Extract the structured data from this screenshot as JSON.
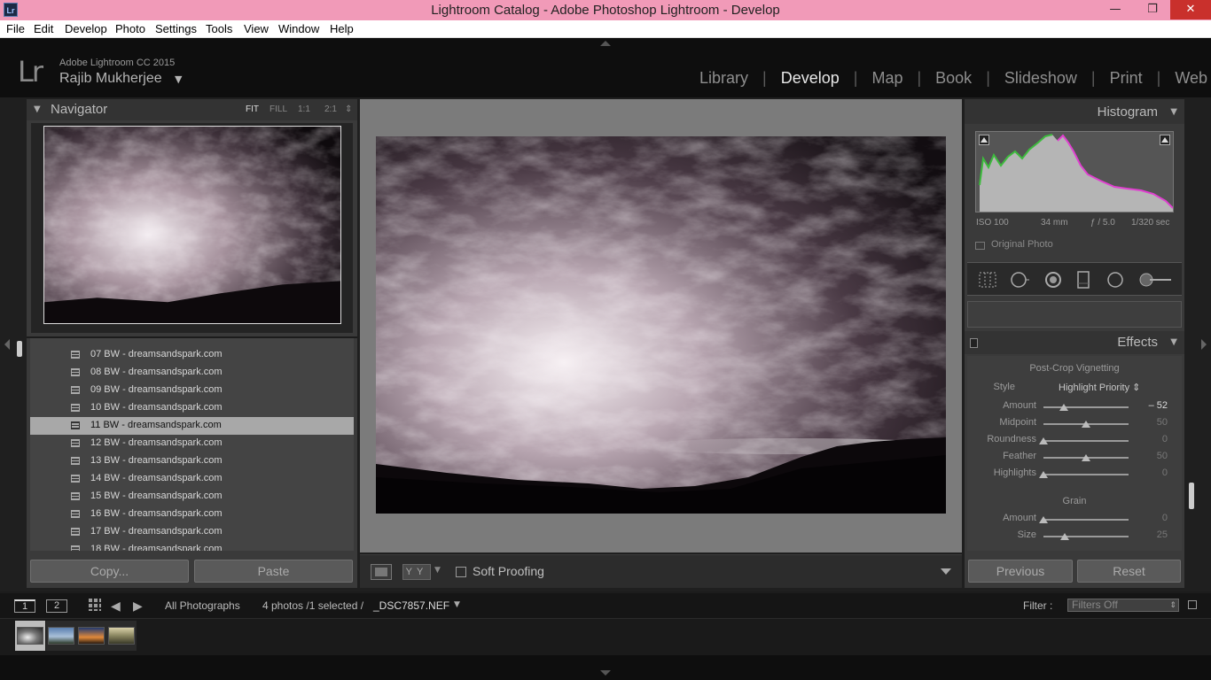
{
  "window": {
    "app_icon_text": "Lr",
    "title": "Lightroom Catalog - Adobe Photoshop Lightroom - Develop",
    "minimize": "—",
    "maximize": "❐",
    "close": "✕"
  },
  "menu": [
    "File",
    "Edit",
    "Develop",
    "Photo",
    "Settings",
    "Tools",
    "View",
    "Window",
    "Help"
  ],
  "identity": {
    "logo": "Lr",
    "product": "Adobe Lightroom CC 2015",
    "user": "Rajib Mukherjee",
    "caret": "▼"
  },
  "modules": [
    {
      "label": "Library",
      "active": false
    },
    {
      "label": "Develop",
      "active": true
    },
    {
      "label": "Map",
      "active": false
    },
    {
      "label": "Book",
      "active": false
    },
    {
      "label": "Slideshow",
      "active": false
    },
    {
      "label": "Print",
      "active": false
    },
    {
      "label": "Web",
      "active": false
    }
  ],
  "navigator": {
    "title": "Navigator",
    "collapse_glyph": "▼",
    "zoom_options": [
      "FIT",
      "FILL",
      "1:1",
      "2:1"
    ],
    "zoom_more": "⇕"
  },
  "snapshots": [
    "07 BW - dreamsandspark.com",
    "08 BW - dreamsandspark.com",
    "09 BW - dreamsandspark.com",
    "10 BW - dreamsandspark.com",
    "11 BW - dreamsandspark.com",
    "12 BW - dreamsandspark.com",
    "13 BW - dreamsandspark.com",
    "14 BW - dreamsandspark.com",
    "15 BW - dreamsandspark.com",
    "16 BW - dreamsandspark.com",
    "17 BW - dreamsandspark.com",
    "18 BW - dreamsandspark.com"
  ],
  "selected_snapshot": "11 BW - dreamsandspark.com",
  "left_buttons": {
    "copy": "Copy...",
    "paste": "Paste"
  },
  "toolbar": {
    "yy": "YY",
    "caret": "▼",
    "soft_proofing": "Soft Proofing"
  },
  "histogram": {
    "title": "Histogram",
    "collapse_glyph": "▼",
    "iso": "ISO 100",
    "focal": "34 mm",
    "aperture": "ƒ / 5.0",
    "shutter": "1/320 sec",
    "original_photo": "Original Photo"
  },
  "effects": {
    "title": "Effects",
    "collapse_glyph": "▼",
    "vignette_section": "Post-Crop Vignetting",
    "style_label": "Style",
    "style_value": "Highlight Priority ⇕",
    "vignette_sliders": [
      {
        "label": "Amount",
        "value": "– 52",
        "level": -0.52,
        "active": true
      },
      {
        "label": "Midpoint",
        "value": "50",
        "level": 0.5,
        "active": false
      },
      {
        "label": "Roundness",
        "value": "0",
        "level": 0.0,
        "active": false
      },
      {
        "label": "Feather",
        "value": "50",
        "level": 0.5,
        "active": false
      },
      {
        "label": "Highlights",
        "value": "0",
        "level": 0.0,
        "active": false
      }
    ],
    "grain_section": "Grain",
    "grain_sliders": [
      {
        "label": "Amount",
        "value": "0"
      },
      {
        "label": "Size",
        "value": "25"
      }
    ]
  },
  "right_buttons": {
    "previous": "Previous",
    "reset": "Reset"
  },
  "filmstrip_bar": {
    "view1": "1",
    "view2": "2",
    "prev": "◀",
    "next": "▶",
    "source": "All Photographs",
    "count": "4 photos /1 selected /",
    "filename": "_DSC7857.NEF",
    "caret": "▼",
    "filter_label": "Filter :",
    "filter_value": "Filters Off"
  },
  "colors": {
    "title_bar": "#f19ab8",
    "close_button": "#c9302c",
    "histogram_green": "#3dbb3d",
    "histogram_magenta": "#e040d0"
  }
}
